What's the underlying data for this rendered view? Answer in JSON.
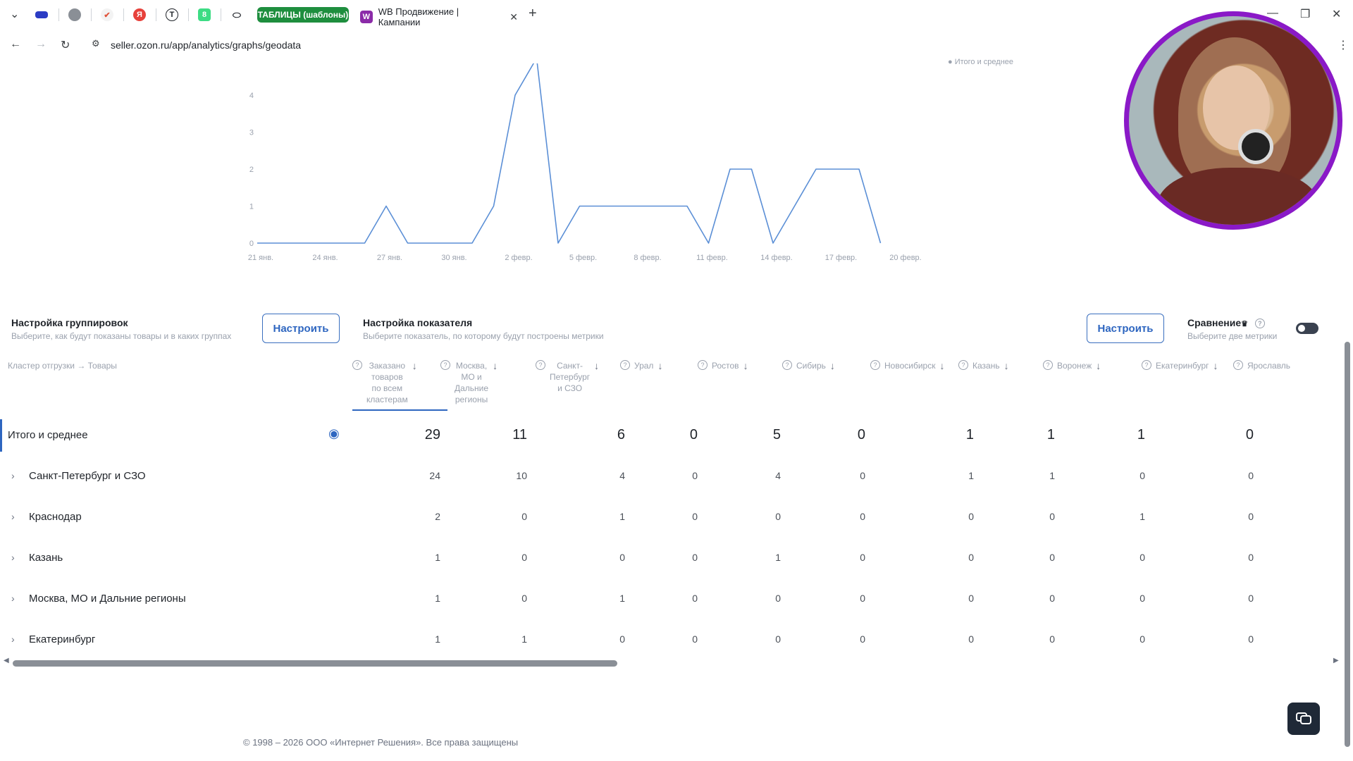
{
  "browser": {
    "tabs": [
      {
        "label": "ТАБЛИЦЫ (шаблоны)",
        "color": "#1e8e3e"
      },
      {
        "label": "WB Продвижение | Кампании",
        "icon": "W"
      }
    ],
    "url": "seller.ozon.ru/app/analytics/graphs/geodata"
  },
  "chart_data": {
    "type": "line",
    "legend": "Итого и среднее",
    "x_ticks": [
      "21 янв.",
      "24 янв.",
      "27 янв.",
      "30 янв.",
      "2 февр.",
      "5 февр.",
      "8 февр.",
      "11 февр.",
      "14 февр.",
      "17 февр.",
      "20 февр."
    ],
    "y_ticks": [
      "0",
      "1",
      "2",
      "3",
      "4"
    ],
    "ylim": [
      0,
      4
    ],
    "series": [
      {
        "color": "#5b8fd6",
        "values": [
          0,
          0,
          0,
          0,
          0,
          0,
          1,
          0,
          0,
          0,
          0,
          1,
          4,
          5,
          0,
          1,
          1,
          1,
          1,
          1,
          1,
          0,
          2,
          2,
          0,
          1,
          2,
          2,
          2,
          0
        ]
      }
    ]
  },
  "settings": {
    "group": {
      "title": "Настройка группировок",
      "subtitle": "Выберите, как будут показаны товары и в каких группах",
      "button": "Настроить"
    },
    "metric": {
      "title": "Настройка показателя",
      "subtitle": "Выберите показатель, по которому будут построены метрики",
      "button": "Настроить"
    },
    "compare": {
      "title": "Сравнение",
      "subtitle": "Выберите две метрики"
    }
  },
  "table": {
    "group_header": "Кластер отгрузки → Товары",
    "columns": [
      {
        "label": "Заказано товаров по всем кластерам",
        "lines": [
          "Заказано",
          "товаров",
          "по всем",
          "кластерам"
        ]
      },
      {
        "label": "Москва, МО и Дальние регионы",
        "lines": [
          "Москва,",
          "МО и",
          "Дальние",
          "регионы"
        ]
      },
      {
        "label": "Санкт-Петербург и СЗО",
        "lines": [
          "Санкт-",
          "Петербург",
          "и СЗО"
        ]
      },
      {
        "label": "Урал",
        "lines": [
          "Урал"
        ]
      },
      {
        "label": "Ростов",
        "lines": [
          "Ростов"
        ]
      },
      {
        "label": "Сибирь",
        "lines": [
          "Сибирь"
        ]
      },
      {
        "label": "Новосибирск",
        "lines": [
          "Новосибирск"
        ]
      },
      {
        "label": "Казань",
        "lines": [
          "Казань"
        ]
      },
      {
        "label": "Воронеж",
        "lines": [
          "Воронеж"
        ]
      },
      {
        "label": "Екатеринбург",
        "lines": [
          "Екатеринбург"
        ]
      },
      {
        "label": "Ярославль",
        "lines": [
          "Ярославль"
        ]
      }
    ],
    "total_row": {
      "name": "Итого и среднее",
      "values": [
        "29",
        "11",
        "6",
        "0",
        "5",
        "0",
        "1",
        "1",
        "1",
        "0"
      ]
    },
    "rows": [
      {
        "name": "Санкт-Петербург и СЗО",
        "values": [
          "24",
          "10",
          "4",
          "0",
          "4",
          "0",
          "1",
          "1",
          "0",
          "0"
        ]
      },
      {
        "name": "Краснодар",
        "values": [
          "2",
          "0",
          "1",
          "0",
          "0",
          "0",
          "0",
          "0",
          "1",
          "0"
        ]
      },
      {
        "name": "Казань",
        "values": [
          "1",
          "0",
          "0",
          "0",
          "1",
          "0",
          "0",
          "0",
          "0",
          "0"
        ]
      },
      {
        "name": "Москва, МО и Дальние регионы",
        "values": [
          "1",
          "0",
          "1",
          "0",
          "0",
          "0",
          "0",
          "0",
          "0",
          "0"
        ]
      },
      {
        "name": "Екатеринбург",
        "values": [
          "1",
          "1",
          "0",
          "0",
          "0",
          "0",
          "0",
          "0",
          "0",
          "0"
        ]
      }
    ]
  },
  "footer": "© 1998 – 2026 ООО «Интернет Решения». Все права защищены"
}
